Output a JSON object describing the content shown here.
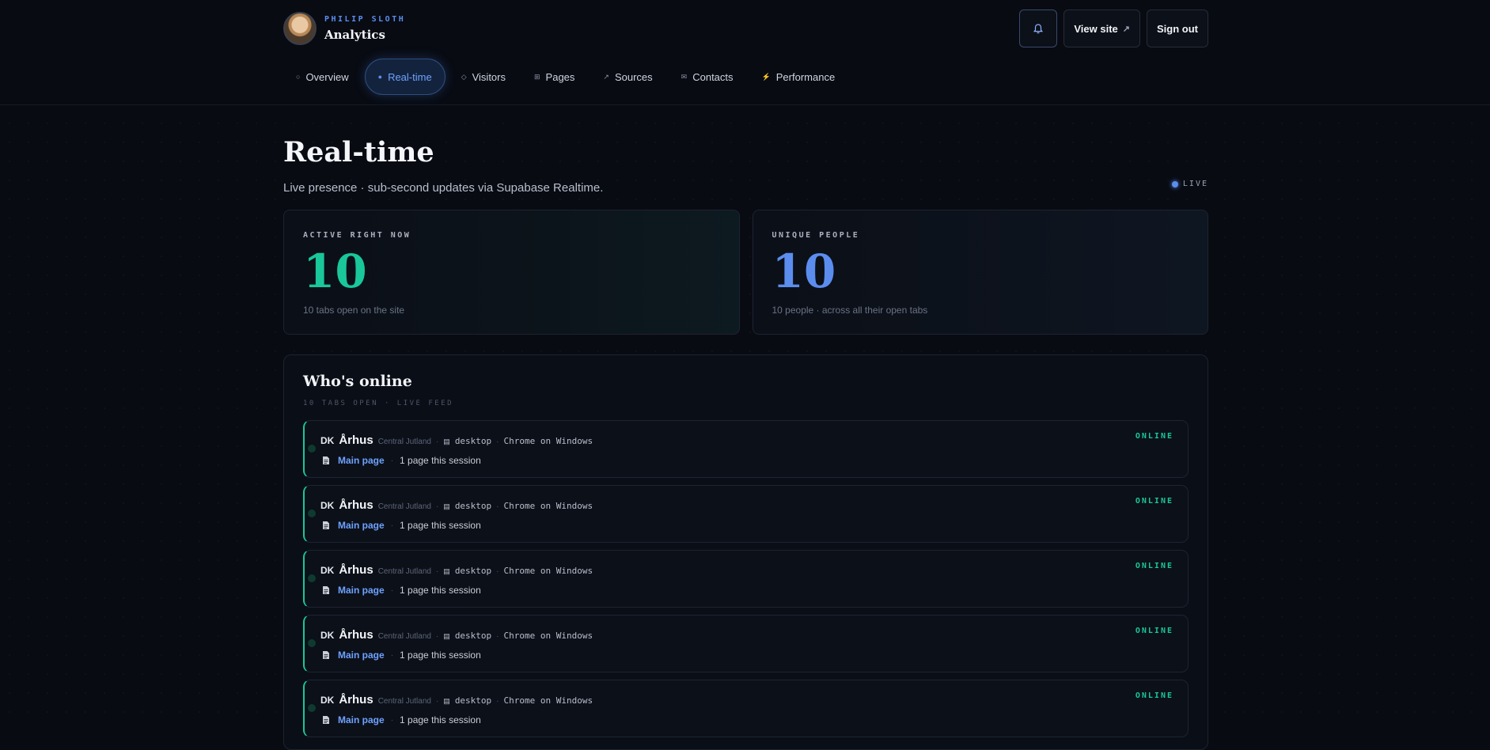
{
  "brand": {
    "owner": "PHILIP SLOTH",
    "name": "Analytics"
  },
  "actions": {
    "bell_icon": "bell-icon",
    "view_site": "View site",
    "view_site_icon": "↗",
    "sign_out": "Sign out"
  },
  "nav": {
    "tabs": [
      {
        "label": "Overview",
        "icon": "○",
        "active": false
      },
      {
        "label": "Real-time",
        "icon": "●",
        "active": true
      },
      {
        "label": "Visitors",
        "icon": "◇",
        "active": false
      },
      {
        "label": "Pages",
        "icon": "⊞",
        "active": false
      },
      {
        "label": "Sources",
        "icon": "↗",
        "active": false
      },
      {
        "label": "Contacts",
        "icon": "✉",
        "active": false
      },
      {
        "label": "Performance",
        "icon": "⚡",
        "active": false
      }
    ]
  },
  "page": {
    "title": "Real-time",
    "subtitle": "Live presence · sub-second updates via Supabase Realtime.",
    "live_label": "LIVE"
  },
  "stats": [
    {
      "label": "ACTIVE RIGHT NOW",
      "value": "10",
      "note": "10 tabs open on the site",
      "color": "#19c79a"
    },
    {
      "label": "UNIQUE PEOPLE",
      "value": "10",
      "note": "10 people · across all their open tabs",
      "color": "#5b8def"
    }
  ],
  "online": {
    "title": "Who's online",
    "subtitle": "10 TABS OPEN · LIVE FEED",
    "rows": [
      {
        "country": "DK",
        "city": "Århus",
        "region": "Central Jutland",
        "device": "desktop",
        "browser": "Chrome on Windows",
        "page": "Main page",
        "session": "1 page this session",
        "status": "ONLINE"
      },
      {
        "country": "DK",
        "city": "Århus",
        "region": "Central Jutland",
        "device": "desktop",
        "browser": "Chrome on Windows",
        "page": "Main page",
        "session": "1 page this session",
        "status": "ONLINE"
      },
      {
        "country": "DK",
        "city": "Århus",
        "region": "Central Jutland",
        "device": "desktop",
        "browser": "Chrome on Windows",
        "page": "Main page",
        "session": "1 page this session",
        "status": "ONLINE"
      },
      {
        "country": "DK",
        "city": "Århus",
        "region": "Central Jutland",
        "device": "desktop",
        "browser": "Chrome on Windows",
        "page": "Main page",
        "session": "1 page this session",
        "status": "ONLINE"
      },
      {
        "country": "DK",
        "city": "Århus",
        "region": "Central Jutland",
        "device": "desktop",
        "browser": "Chrome on Windows",
        "page": "Main page",
        "session": "1 page this session",
        "status": "ONLINE"
      }
    ]
  },
  "colors": {
    "accent": "#5b8def",
    "online": "#19c79a",
    "performance_icon": "#f06b4a"
  }
}
